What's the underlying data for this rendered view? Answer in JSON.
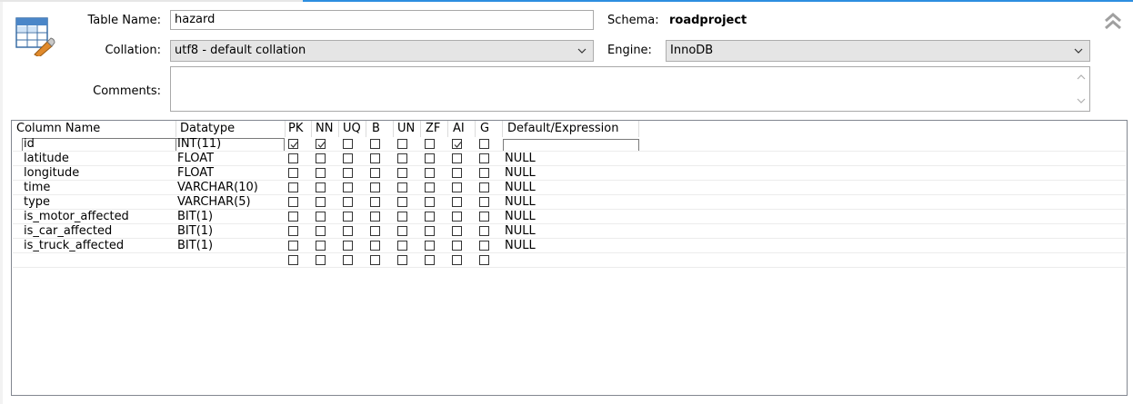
{
  "form": {
    "table_name_label": "Table Name:",
    "table_name_value": "hazard",
    "schema_label": "Schema:",
    "schema_value": "roadproject",
    "collation_label": "Collation:",
    "collation_value": "utf8 - default collation",
    "engine_label": "Engine:",
    "engine_value": "InnoDB",
    "comments_label": "Comments:",
    "comments_value": ""
  },
  "grid": {
    "headers": {
      "column_name": "Column Name",
      "datatype": "Datatype",
      "pk": "PK",
      "nn": "NN",
      "uq": "UQ",
      "b": "B",
      "un": "UN",
      "zf": "ZF",
      "ai": "AI",
      "g": "G",
      "default": "Default/Expression"
    },
    "rows": [
      {
        "name": "id",
        "type": "INT(11)",
        "default": "",
        "flags": [
          true,
          true,
          false,
          false,
          false,
          false,
          true,
          false
        ]
      },
      {
        "name": "latitude",
        "type": "FLOAT",
        "default": "NULL",
        "flags": [
          false,
          false,
          false,
          false,
          false,
          false,
          false,
          false
        ]
      },
      {
        "name": "longitude",
        "type": "FLOAT",
        "default": "NULL",
        "flags": [
          false,
          false,
          false,
          false,
          false,
          false,
          false,
          false
        ]
      },
      {
        "name": "time",
        "type": "VARCHAR(10)",
        "default": "NULL",
        "flags": [
          false,
          false,
          false,
          false,
          false,
          false,
          false,
          false
        ]
      },
      {
        "name": "type",
        "type": "VARCHAR(5)",
        "default": "NULL",
        "flags": [
          false,
          false,
          false,
          false,
          false,
          false,
          false,
          false
        ]
      },
      {
        "name": "is_motor_affected",
        "type": "BIT(1)",
        "default": "NULL",
        "flags": [
          false,
          false,
          false,
          false,
          false,
          false,
          false,
          false
        ]
      },
      {
        "name": "is_car_affected",
        "type": "BIT(1)",
        "default": "NULL",
        "flags": [
          false,
          false,
          false,
          false,
          false,
          false,
          false,
          false
        ]
      },
      {
        "name": "is_truck_affected",
        "type": "BIT(1)",
        "default": "NULL",
        "flags": [
          false,
          false,
          false,
          false,
          false,
          false,
          false,
          false
        ]
      },
      {
        "name": "",
        "type": "",
        "default": "",
        "flags": [
          false,
          false,
          false,
          false,
          false,
          false,
          false,
          false
        ]
      }
    ]
  },
  "icons": {
    "table": "table-edit-icon",
    "collapse": "double-chevron-up-icon",
    "dropdown": "chevron-down-icon"
  },
  "colors": {
    "accent": "#2d8ee0",
    "select_bg": "#e5e5e5",
    "border": "#a9a9a9"
  }
}
